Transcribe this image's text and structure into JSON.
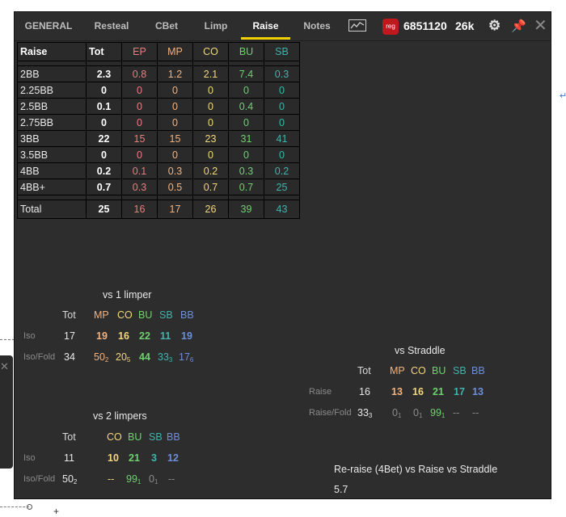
{
  "tabs": [
    {
      "label": "GENERAL",
      "active": false
    },
    {
      "label": "Resteal",
      "active": false
    },
    {
      "label": "CBet",
      "active": false
    },
    {
      "label": "Limp",
      "active": false
    },
    {
      "label": "Raise",
      "active": true
    },
    {
      "label": "Notes",
      "active": false
    }
  ],
  "header": {
    "reg_badge": "reg",
    "player_id": "6851120",
    "hands": "26k",
    "icons": [
      "chart-icon",
      "gear-icon",
      "pin-icon",
      "close-icon"
    ],
    "colors": {
      "active_tab_underline": "#f0d000",
      "reg_badge": "#c0181e"
    }
  },
  "raise_table": {
    "headers": [
      "Raise",
      "Tot",
      "EP",
      "MP",
      "CO",
      "BU",
      "SB"
    ],
    "rows": [
      [
        "2BB",
        "2.3",
        "0.8",
        "1.2",
        "2.1",
        "7.4",
        "0.3"
      ],
      [
        "2.25BB",
        "0",
        "0",
        "0",
        "0",
        "0",
        "0"
      ],
      [
        "2.5BB",
        "0.1",
        "0",
        "0",
        "0",
        "0.4",
        "0"
      ],
      [
        "2.75BB",
        "0",
        "0",
        "0",
        "0",
        "0",
        "0"
      ],
      [
        "3BB",
        "22",
        "15",
        "15",
        "23",
        "31",
        "41"
      ],
      [
        "3.5BB",
        "0",
        "0",
        "0",
        "0",
        "0",
        "0"
      ],
      [
        "4BB",
        "0.2",
        "0.1",
        "0.3",
        "0.2",
        "0.3",
        "0.2"
      ],
      [
        "4BB+",
        "0.7",
        "0.3",
        "0.5",
        "0.7",
        "0.7",
        "25"
      ]
    ],
    "total": [
      "Total",
      "25",
      "16",
      "17",
      "26",
      "39",
      "43"
    ]
  },
  "vs1": {
    "title": "vs 1 limper",
    "headers": [
      "Tot",
      "MP",
      "CO",
      "BU",
      "SB",
      "BB"
    ],
    "iso": {
      "label": "Iso",
      "tot": "17",
      "values": [
        "19",
        "16",
        "22",
        "11",
        "19"
      ]
    },
    "isofold": {
      "label": "Iso/Fold",
      "tot": "34",
      "values": [
        "50",
        "20",
        "44",
        "33",
        "17"
      ],
      "subs": [
        "2",
        "5",
        "",
        "3",
        "6"
      ]
    }
  },
  "vs2": {
    "title": "vs 2 limpers",
    "headers": [
      "Tot",
      "CO",
      "BU",
      "SB",
      "BB"
    ],
    "iso": {
      "label": "Iso",
      "tot": "11",
      "values": [
        "10",
        "21",
        "3",
        "12"
      ]
    },
    "isofold": {
      "label": "Iso/Fold",
      "tot": "50",
      "tot_sub": "2",
      "values": [
        "--",
        "99",
        "0",
        "--"
      ],
      "subs": [
        "",
        "1",
        "1",
        ""
      ]
    }
  },
  "straddle": {
    "title": "vs Straddle",
    "headers": [
      "Tot",
      "MP",
      "CO",
      "BU",
      "SB",
      "BB"
    ],
    "raise": {
      "label": "Raise",
      "tot": "16",
      "values": [
        "13",
        "16",
        "21",
        "17",
        "13"
      ]
    },
    "raisefold": {
      "label": "Raise/Fold",
      "tot": "33",
      "tot_sub": "3",
      "values": [
        "0",
        "0",
        "99",
        "--",
        "--"
      ],
      "subs": [
        "1",
        "1",
        "1",
        "",
        ""
      ]
    }
  },
  "reraise": {
    "title": "Re-raise (4Bet) vs Raise vs Straddle",
    "value": "5.7"
  }
}
